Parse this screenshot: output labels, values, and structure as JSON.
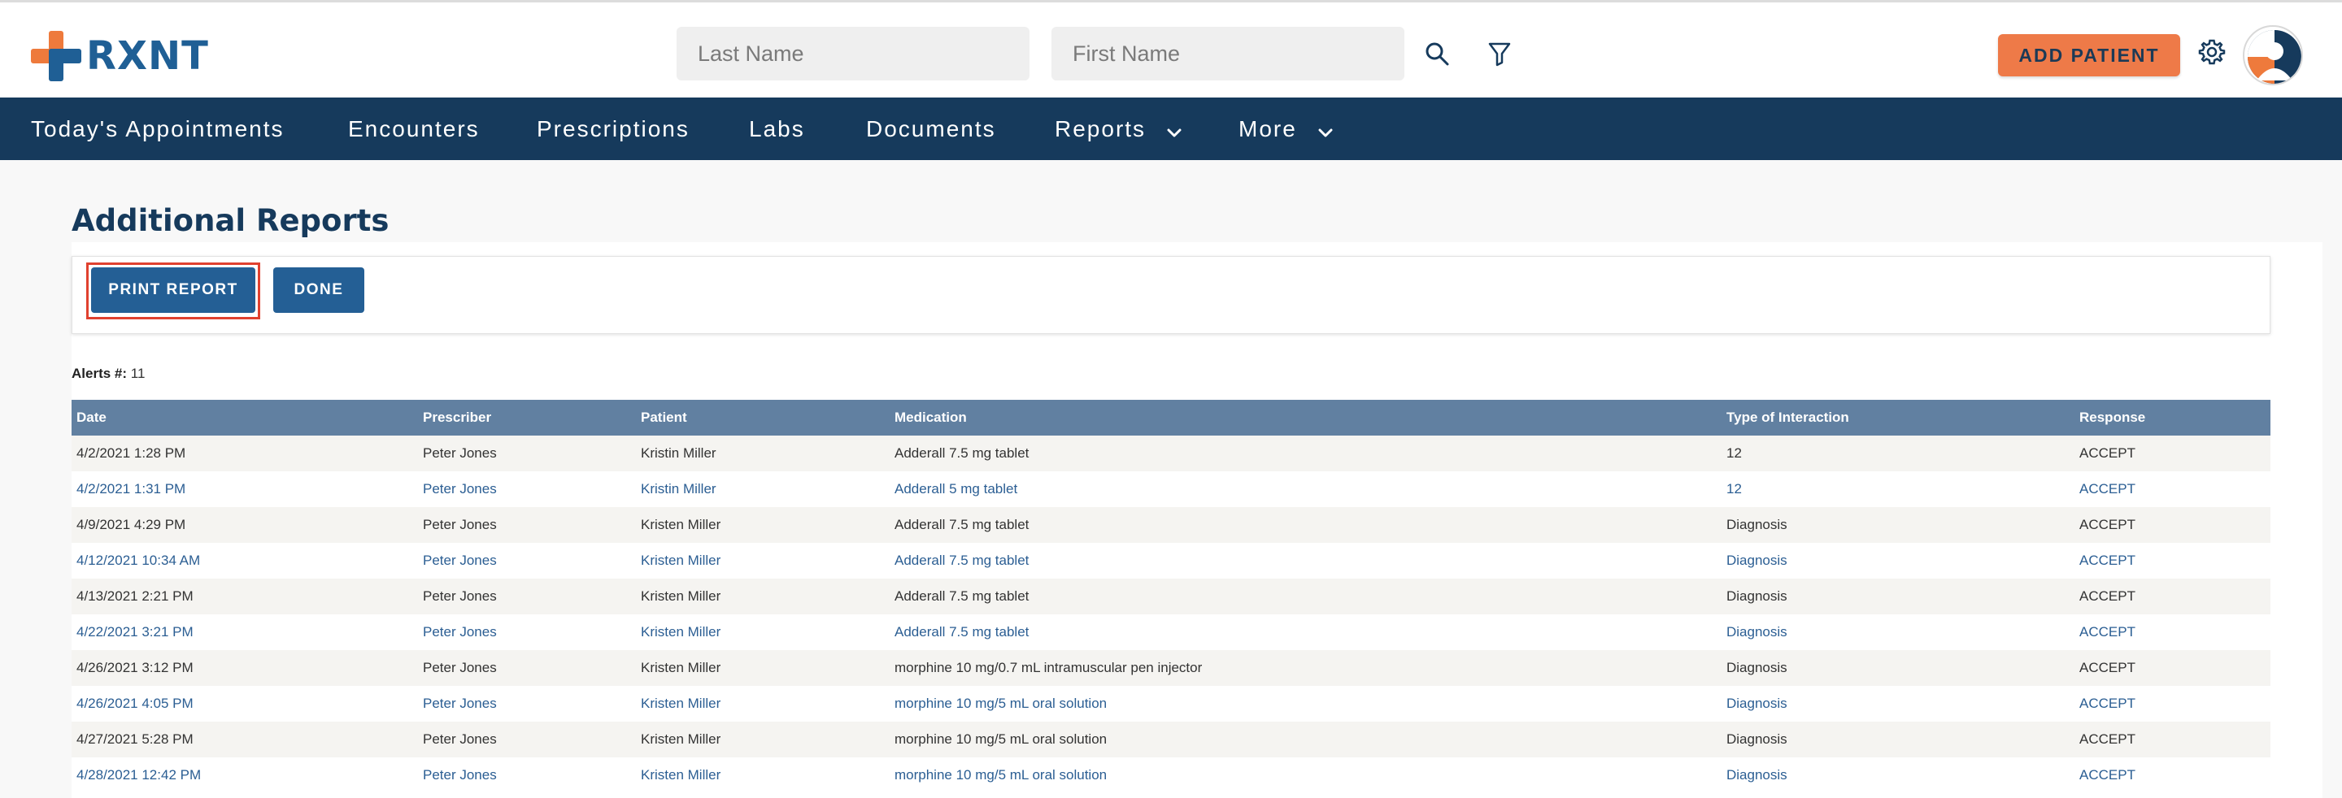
{
  "brand": {
    "name": "RXNT"
  },
  "search": {
    "last_name_placeholder": "Last Name",
    "first_name_placeholder": "First Name"
  },
  "header": {
    "add_patient_label": "ADD PATIENT"
  },
  "nav": {
    "items": [
      {
        "label": "Today's Appointments"
      },
      {
        "label": "Encounters"
      },
      {
        "label": "Prescriptions"
      },
      {
        "label": "Labs"
      },
      {
        "label": "Documents"
      },
      {
        "label": "Reports"
      },
      {
        "label": "More"
      }
    ]
  },
  "page": {
    "title": "Additional Reports",
    "print_label": "PRINT REPORT",
    "done_label": "DONE",
    "alerts_label": "Alerts #:",
    "alerts_count": "11"
  },
  "table": {
    "columns": [
      "Date",
      "Prescriber",
      "Patient",
      "Medication",
      "Type of Interaction",
      "Response"
    ],
    "rows": [
      {
        "date": "4/2/2021 1:28 PM",
        "prescriber": "Peter Jones",
        "patient": "Kristin Miller",
        "medication": "Adderall 7.5 mg tablet",
        "interaction": "12",
        "response": "ACCEPT"
      },
      {
        "date": "4/2/2021 1:31 PM",
        "prescriber": "Peter Jones",
        "patient": "Kristin Miller",
        "medication": "Adderall 5 mg tablet",
        "interaction": "12",
        "response": "ACCEPT"
      },
      {
        "date": "4/9/2021 4:29 PM",
        "prescriber": "Peter Jones",
        "patient": "Kristen Miller",
        "medication": "Adderall 7.5 mg tablet",
        "interaction": "Diagnosis",
        "response": "ACCEPT"
      },
      {
        "date": "4/12/2021 10:34 AM",
        "prescriber": "Peter Jones",
        "patient": "Kristen Miller",
        "medication": "Adderall 7.5 mg tablet",
        "interaction": "Diagnosis",
        "response": "ACCEPT"
      },
      {
        "date": "4/13/2021 2:21 PM",
        "prescriber": "Peter Jones",
        "patient": "Kristen Miller",
        "medication": "Adderall 7.5 mg tablet",
        "interaction": "Diagnosis",
        "response": "ACCEPT"
      },
      {
        "date": "4/22/2021 3:21 PM",
        "prescriber": "Peter Jones",
        "patient": "Kristen Miller",
        "medication": "Adderall 7.5 mg tablet",
        "interaction": "Diagnosis",
        "response": "ACCEPT"
      },
      {
        "date": "4/26/2021 3:12 PM",
        "prescriber": "Peter Jones",
        "patient": "Kristen Miller",
        "medication": "morphine 10 mg/0.7 mL intramuscular pen injector",
        "interaction": "Diagnosis",
        "response": "ACCEPT"
      },
      {
        "date": "4/26/2021 4:05 PM",
        "prescriber": "Peter Jones",
        "patient": "Kristen Miller",
        "medication": "morphine 10 mg/5 mL oral solution",
        "interaction": "Diagnosis",
        "response": "ACCEPT"
      },
      {
        "date": "4/27/2021 5:28 PM",
        "prescriber": "Peter Jones",
        "patient": "Kristen Miller",
        "medication": "morphine 10 mg/5 mL oral solution",
        "interaction": "Diagnosis",
        "response": "ACCEPT"
      },
      {
        "date": "4/28/2021 12:42 PM",
        "prescriber": "Peter Jones",
        "patient": "Kristen Miller",
        "medication": "morphine 10 mg/5 mL oral solution",
        "interaction": "Diagnosis",
        "response": "ACCEPT"
      }
    ]
  },
  "colors": {
    "brand_blue": "#1f5f95",
    "brand_orange": "#ee7a3c",
    "nav_bg": "#163a5c",
    "table_header_bg": "#6180a1",
    "button_blue": "#245f95",
    "highlight_red": "#e0412f",
    "link_blue": "#2b5e93"
  },
  "icons": {
    "search": "search-icon",
    "filter": "filter-icon",
    "settings": "gear-icon",
    "avatar": "user-avatar-icon",
    "dropdown": "chevron-down-icon"
  }
}
